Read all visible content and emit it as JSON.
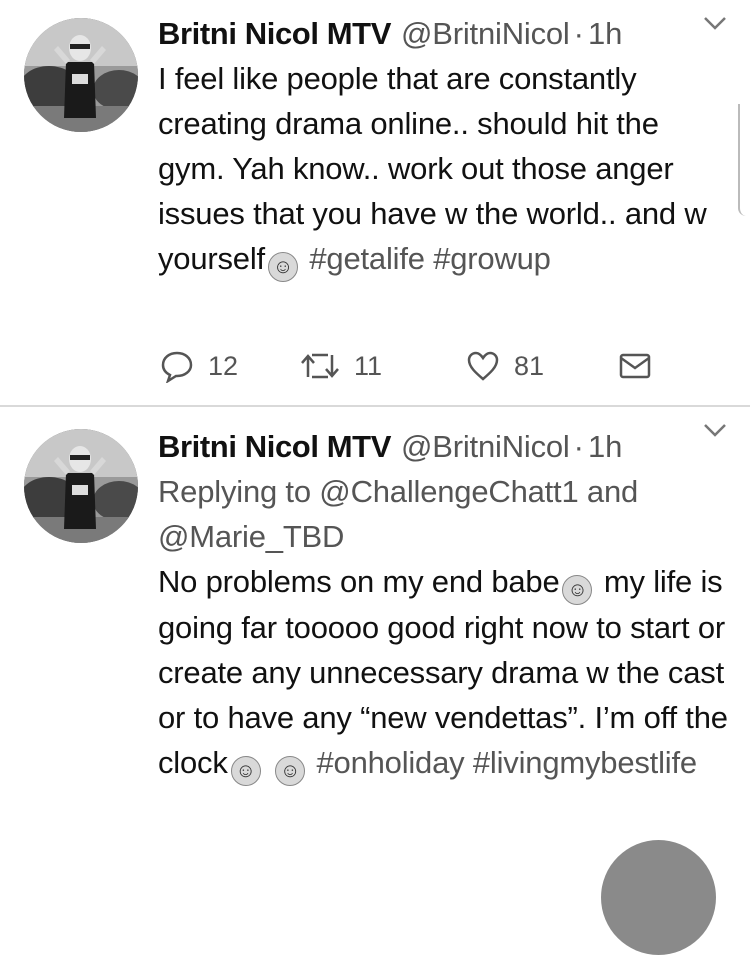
{
  "tweets": [
    {
      "name": "Britni Nicol MTV",
      "handle": "@BritniNicol",
      "separator": "·",
      "time": "1h",
      "text_parts": [
        "I feel like people that are constantly creating drama online.. should hit the gym. Yah know.. work out those anger issues that you have w the world.. and w yourself",
        "#getalife",
        "#growup"
      ],
      "emojis": [
        "woman-gesturing-no-emoji"
      ],
      "actions": {
        "replies": "12",
        "retweets": "11",
        "likes": "81"
      }
    },
    {
      "name": "Britni Nicol MTV",
      "handle": "@BritniNicol",
      "separator": "·",
      "time": "1h",
      "replying_to": "Replying to @ChallengeChatt1 and @Marie_TBD",
      "text_parts": [
        "No problems on my end babe",
        "my life is going far tooooo good right now to start or create any unnecessary drama w the cast or to have any “new vendettas”. I’m off the clock",
        "#onholiday",
        "#livingmybestlife"
      ],
      "emojis": [
        "face-blowing-kiss-emoji",
        "woman-gesturing-no-emoji",
        "upside-down-face-emoji"
      ]
    }
  ],
  "colors": {
    "text": "#111111",
    "secondary": "#555555",
    "divider": "#d9d9d9"
  }
}
